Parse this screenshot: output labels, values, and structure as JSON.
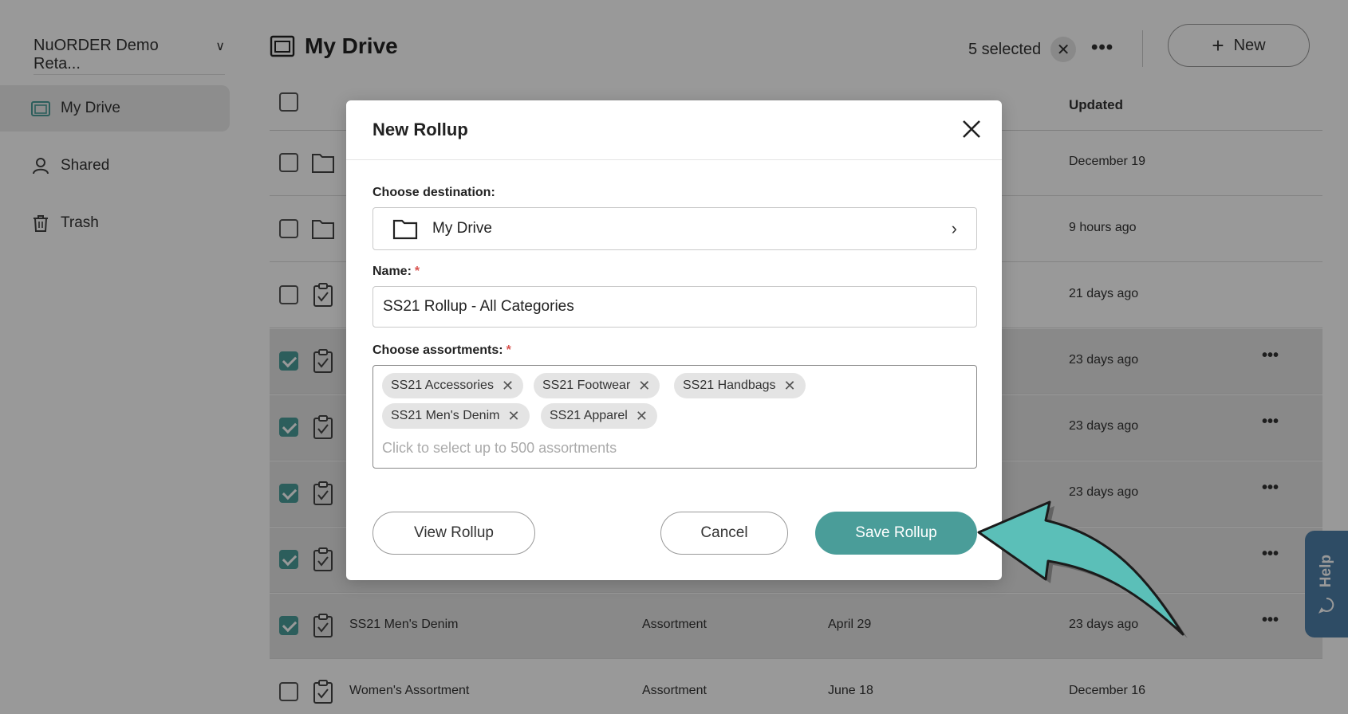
{
  "sidebar": {
    "org_name": "NuORDER Demo Reta...",
    "items": [
      {
        "label": "My Drive",
        "icon": "folder-icon",
        "active": true
      },
      {
        "label": "Shared",
        "icon": "person-icon",
        "active": false
      },
      {
        "label": "Trash",
        "icon": "trash-icon",
        "active": false
      }
    ]
  },
  "header": {
    "title": "My Drive",
    "selected_label": "5 selected",
    "new_label": "New"
  },
  "table": {
    "col_updated": "Updated",
    "rows": [
      {
        "name": "",
        "type": "",
        "date": "",
        "updated": "December 19",
        "kind": "folder",
        "checked": false
      },
      {
        "name": "",
        "type": "",
        "date": "",
        "updated": "9 hours ago",
        "kind": "folder",
        "checked": false
      },
      {
        "name": "",
        "type": "",
        "date": "",
        "updated": "21 days ago",
        "kind": "assortment",
        "checked": false
      },
      {
        "name": "",
        "type": "",
        "date": "",
        "updated": "23 days ago",
        "kind": "assortment",
        "checked": true
      },
      {
        "name": "",
        "type": "",
        "date": "",
        "updated": "23 days ago",
        "kind": "assortment",
        "checked": true
      },
      {
        "name": "",
        "type": "",
        "date": "",
        "updated": "23 days ago",
        "kind": "assortment",
        "checked": true
      },
      {
        "name": "",
        "type": "",
        "date": "",
        "updated": "",
        "kind": "assortment",
        "checked": true
      },
      {
        "name": "SS21 Men's Denim",
        "type": "Assortment",
        "date": "April 29",
        "updated": "23 days ago",
        "kind": "assortment",
        "checked": true
      },
      {
        "name": "Women's Assortment",
        "type": "Assortment",
        "date": "June 18",
        "updated": "December 16",
        "kind": "assortment",
        "checked": false
      }
    ]
  },
  "help_label": "Help",
  "modal": {
    "title": "New Rollup",
    "destination_label": "Choose destination:",
    "destination_value": "My Drive",
    "name_label": "Name:",
    "required_mark": "*",
    "name_value": "SS21 Rollup - All Categories",
    "assortments_label": "Choose assortments:",
    "chips": [
      "SS21 Accessories",
      "SS21 Footwear",
      "SS21 Handbags",
      "SS21 Men's Denim",
      "SS21 Apparel"
    ],
    "assortments_placeholder": "Click to select up to 500 assortments",
    "view_button": "View Rollup",
    "cancel_button": "Cancel",
    "save_button": "Save Rollup"
  },
  "colors": {
    "accent": "#4a9d99",
    "arrow": "#5bbfb8",
    "help_tab": "#4d7fa8",
    "required": "#d9534f"
  }
}
